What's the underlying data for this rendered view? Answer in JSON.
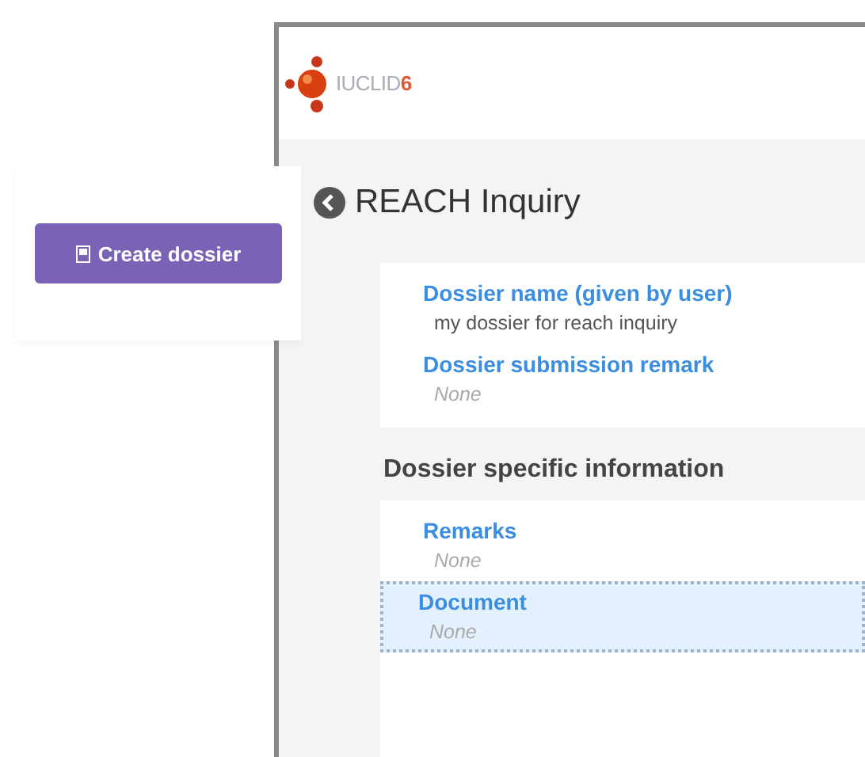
{
  "logo": {
    "name": "IUCLID",
    "version": "6"
  },
  "page_title": "REACH Inquiry",
  "create_button": {
    "label": "Create dossier"
  },
  "general_fields": [
    {
      "label": "Dossier name (given by user)",
      "value": "my dossier for reach inquiry",
      "empty": false
    },
    {
      "label": "Dossier submission remark",
      "value": "None",
      "empty": true
    }
  ],
  "section_heading": "Dossier specific information",
  "specific_fields": [
    {
      "label": "Remarks",
      "value": "None",
      "empty": true,
      "selected": false
    },
    {
      "label": "Document",
      "value": "None",
      "empty": true,
      "selected": true
    }
  ]
}
